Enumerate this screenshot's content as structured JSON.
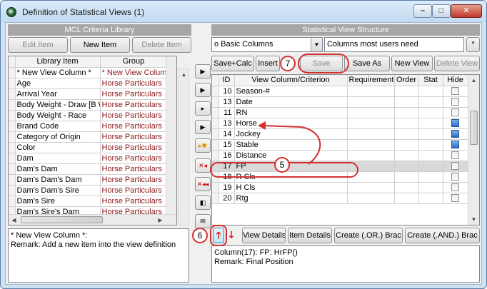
{
  "window": {
    "title": "Definition of Statistical Views  (1)"
  },
  "library": {
    "header": "MCL Criteria Library",
    "buttons": {
      "edit": "Edit Item",
      "new": "New Item",
      "delete": "Delete Item"
    },
    "columns": {
      "item": "Library Item",
      "group": "Group"
    },
    "rows": [
      {
        "item": "* New View Column *",
        "group": "* New View Column"
      },
      {
        "item": "Age",
        "group": "Horse Particulars"
      },
      {
        "item": "Arrival Year",
        "group": "Horse Particulars"
      },
      {
        "item": "Body Weight - Draw [B W",
        "group": "Horse Particulars"
      },
      {
        "item": "Body Weight - Race",
        "group": "Horse Particulars"
      },
      {
        "item": "Brand Code",
        "group": "Horse Particulars"
      },
      {
        "item": "Category of Origin",
        "group": "Horse Particulars"
      },
      {
        "item": "Color",
        "group": "Horse Particulars"
      },
      {
        "item": "Dam",
        "group": "Horse Particulars"
      },
      {
        "item": "Dam's Dam",
        "group": "Horse Particulars"
      },
      {
        "item": "Dam's Dam's Dam",
        "group": "Horse Particulars"
      },
      {
        "item": "Dam's Dam's Sire",
        "group": "Horse Particulars"
      },
      {
        "item": "Dam's Sire",
        "group": "Horse Particulars"
      },
      {
        "item": "Dam's Sire's Dam",
        "group": "Horse Particulars"
      }
    ],
    "description_line1": "* New View Column *:",
    "description_line2": "Remark: Add a new item into the view definition"
  },
  "structure": {
    "header": "Statistical View Structure",
    "view_select": "o Basic Columns",
    "view_note": "Columns most users need",
    "asterisk_button": "*",
    "buttons": {
      "save_calc": "Save+Calc",
      "insert": "Insert",
      "save": "Save",
      "save_as": "Save As",
      "new_view": "New View",
      "delete_view": "Delete View"
    },
    "columns": {
      "id": "ID",
      "criterion": "View Column/Criterion",
      "requirement": "Requirement",
      "order": "Order",
      "stat": "Stat",
      "hide": "Hide"
    },
    "rows": [
      {
        "id": "10",
        "name": "Season-#",
        "hide": false
      },
      {
        "id": "13",
        "name": "Date",
        "hide": false
      },
      {
        "id": "11",
        "name": "RN",
        "hide": false
      },
      {
        "id": "13",
        "name": "Horse",
        "hide": true
      },
      {
        "id": "14",
        "name": "Jockey",
        "hide": true
      },
      {
        "id": "15",
        "name": "Stable",
        "hide": true
      },
      {
        "id": "16",
        "name": "Distance",
        "hide": false
      },
      {
        "id": "17",
        "name": "FP",
        "hide": false
      },
      {
        "id": "18",
        "name": "R Cls",
        "hide": false
      },
      {
        "id": "19",
        "name": "H Cls",
        "hide": false
      },
      {
        "id": "20",
        "name": "Rtg",
        "hide": false
      }
    ],
    "bottom_buttons": {
      "view_details": "View Details",
      "item_details": "Item Details",
      "create_or": "Create (.OR.) Brac",
      "create_and": "Create (.AND.) Brac"
    },
    "description_line1": "Column(17): FP: HrFP()",
    "description_line2": "Remark: Final Position"
  },
  "tools": {
    "icons": [
      "move-right-icon",
      "insert-right-icon",
      "insert-right-alt-icon",
      "insert-column-icon",
      "add-star-icon",
      "delete-icon",
      "delete-all-icon",
      "copy-icon",
      "mail-icon"
    ]
  },
  "callouts": {
    "c5": "5",
    "c6": "6",
    "c7": "7"
  },
  "colors": {
    "callout": "#d32f2f",
    "group_text": "#8b1a1a",
    "panel_header": "#a6a6a6"
  }
}
